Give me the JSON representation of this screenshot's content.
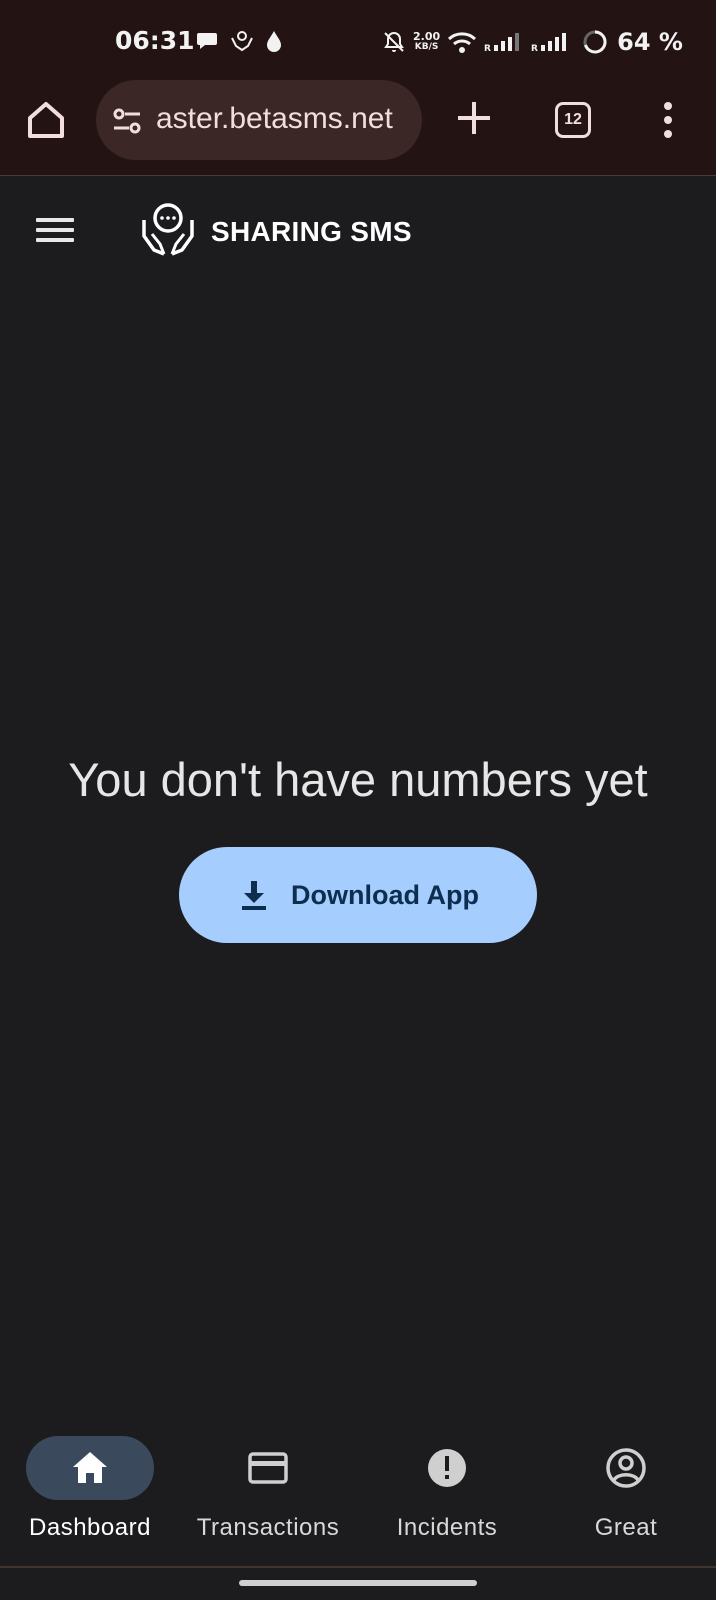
{
  "status_bar": {
    "time": "06:31",
    "net_speed_value": "2.00",
    "net_speed_unit": "KB/S",
    "battery": "64 %"
  },
  "browser": {
    "url": "aster.betasms.net",
    "tab_count": "12"
  },
  "header": {
    "brand": "SHARING SMS"
  },
  "main": {
    "empty_message": "You don't have numbers yet",
    "download_label": "Download App"
  },
  "bottom_nav": {
    "items": [
      {
        "label": "Dashboard",
        "icon": "home-icon",
        "active": true
      },
      {
        "label": "Transactions",
        "icon": "card-icon",
        "active": false
      },
      {
        "label": "Incidents",
        "icon": "alert-icon",
        "active": false
      },
      {
        "label": "Great",
        "icon": "account-icon",
        "active": false
      }
    ]
  },
  "colors": {
    "chrome_bg": "#231313",
    "page_bg": "#1c1c1e",
    "button_bg": "#a5cdfd",
    "active_nav_pill": "#3a4a5c"
  }
}
